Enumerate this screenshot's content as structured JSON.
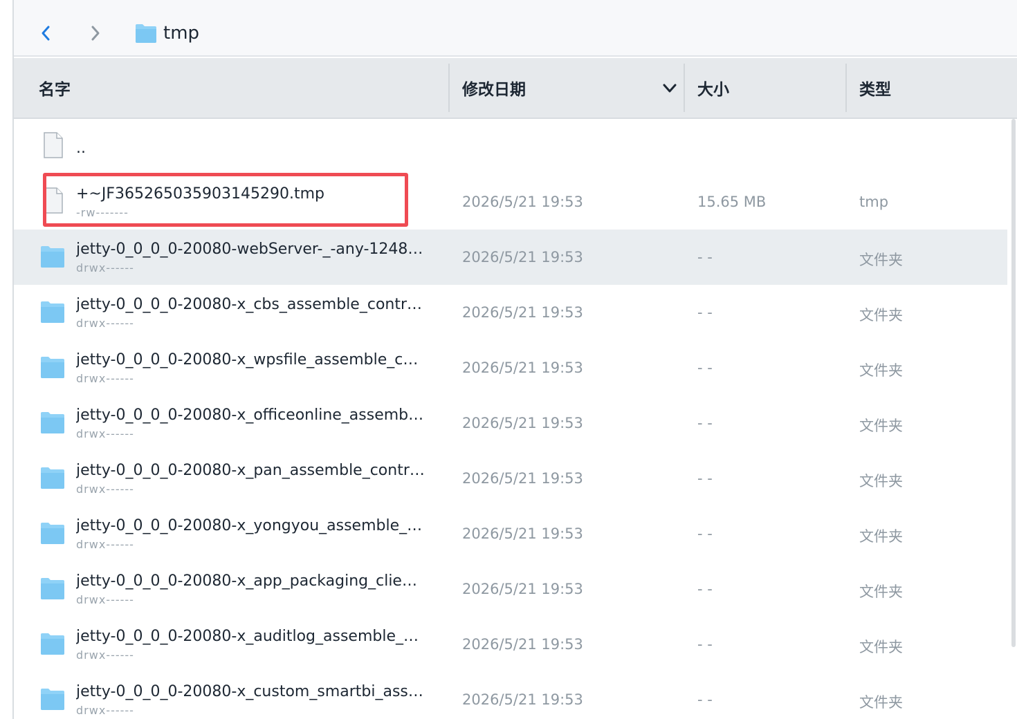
{
  "toolbar": {
    "back_icon": "chevron-left-icon",
    "forward_icon": "chevron-right-icon",
    "path_icon": "folder-icon",
    "path_title": "tmp"
  },
  "columns": {
    "name": "名字",
    "date": "修改日期",
    "size": "大小",
    "type": "类型",
    "sort_icon": "chevron-down-icon"
  },
  "colors": {
    "accent_blue": "#1e7be0",
    "folder_blue": "#8fd2f7",
    "highlight_red": "#ef4b53",
    "selected_row": "#e9edf0"
  },
  "rows": [
    {
      "kind": "parent",
      "name": "..",
      "perm": "",
      "date": "",
      "size": "",
      "type": ""
    },
    {
      "kind": "file",
      "name": "+~JF365265035903145290.tmp",
      "perm": "-rw-------",
      "date": "2026/5/21 19:53",
      "size": "15.65 MB",
      "type": "tmp"
    },
    {
      "kind": "folder",
      "name": "jetty-0_0_0_0-20080-webServer-_-any-1248…",
      "perm": "drwx------",
      "date": "2026/5/21 19:53",
      "size": "- -",
      "type": "文件夹"
    },
    {
      "kind": "folder",
      "name": "jetty-0_0_0_0-20080-x_cbs_assemble_contr…",
      "perm": "drwx------",
      "date": "2026/5/21 19:53",
      "size": "- -",
      "type": "文件夹"
    },
    {
      "kind": "folder",
      "name": "jetty-0_0_0_0-20080-x_wpsfile_assemble_c…",
      "perm": "drwx------",
      "date": "2026/5/21 19:53",
      "size": "- -",
      "type": "文件夹"
    },
    {
      "kind": "folder",
      "name": "jetty-0_0_0_0-20080-x_officeonline_assemb…",
      "perm": "drwx------",
      "date": "2026/5/21 19:53",
      "size": "- -",
      "type": "文件夹"
    },
    {
      "kind": "folder",
      "name": "jetty-0_0_0_0-20080-x_pan_assemble_contr…",
      "perm": "drwx------",
      "date": "2026/5/21 19:53",
      "size": "- -",
      "type": "文件夹"
    },
    {
      "kind": "folder",
      "name": "jetty-0_0_0_0-20080-x_yongyou_assemble_…",
      "perm": "drwx------",
      "date": "2026/5/21 19:53",
      "size": "- -",
      "type": "文件夹"
    },
    {
      "kind": "folder",
      "name": "jetty-0_0_0_0-20080-x_app_packaging_clie…",
      "perm": "drwx------",
      "date": "2026/5/21 19:53",
      "size": "- -",
      "type": "文件夹"
    },
    {
      "kind": "folder",
      "name": "jetty-0_0_0_0-20080-x_auditlog_assemble_…",
      "perm": "drwx------",
      "date": "2026/5/21 19:53",
      "size": "- -",
      "type": "文件夹"
    },
    {
      "kind": "folder",
      "name": "jetty-0_0_0_0-20080-x_custom_smartbi_ass…",
      "perm": "drwx------",
      "date": "2026/5/21 19:53",
      "size": "- -",
      "type": "文件夹"
    }
  ]
}
